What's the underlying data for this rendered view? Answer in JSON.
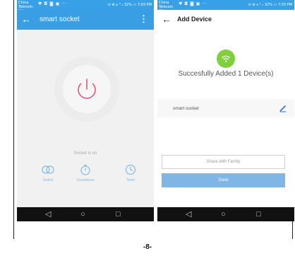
{
  "statusbar": {
    "carrier": "China Telecom China Mobile",
    "indicators": "♥ ◘ ◙ ▣ ···",
    "right_text": "⊙ ⊕ ⌂ ² ᵢₗ 32% ▭ 7:03 PM"
  },
  "left_screen": {
    "title": "smart socket",
    "back_label": "←",
    "menu_label": "⋮",
    "status_text": "Socket is on",
    "controls": [
      {
        "label": "Switch",
        "icon": "switch-icon"
      },
      {
        "label": "Countdown",
        "icon": "countdown-icon"
      },
      {
        "label": "Timer",
        "icon": "timer-icon"
      }
    ],
    "accent_color": "#3a9ee4",
    "power_color": "#e0577f"
  },
  "right_screen": {
    "title": "Add Device",
    "back_label": "←",
    "success_message": "Succesfully Added 1 Device(s)",
    "device_name": "smart socket",
    "share_label": "Share with Family",
    "done_label": "Done",
    "success_color": "#7fd13b"
  },
  "navbar": {
    "back": "◁",
    "home": "○",
    "recent": "□"
  },
  "page_number": "-8-"
}
